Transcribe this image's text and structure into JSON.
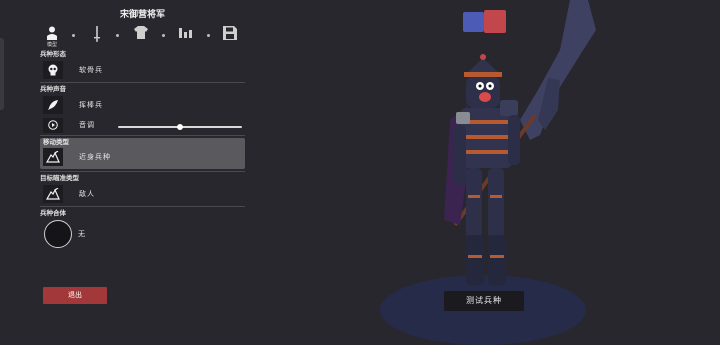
{
  "title": "宋御营将军",
  "tabs": [
    {
      "icon": "unit-icon",
      "label": "模型"
    },
    {
      "icon": "sword-icon",
      "label": ""
    },
    {
      "icon": "armor-icon",
      "label": ""
    },
    {
      "icon": "stats-icon",
      "label": ""
    },
    {
      "icon": "save-icon",
      "label": ""
    }
  ],
  "sections": {
    "form": {
      "title": "兵种形态",
      "value": "软骨兵"
    },
    "voice": {
      "title": "兵种声音",
      "value": "挥棒兵",
      "pitch_label": "音调",
      "pitch_level": 0.5
    },
    "movement": {
      "title": "移动类型",
      "value": "近身兵种"
    },
    "targeting": {
      "title": "目标瞄准类型",
      "value": "敌人"
    },
    "fusion": {
      "title": "兵种合体",
      "value": "无"
    }
  },
  "exit_label": "退出",
  "test_label": "测试兵种",
  "colors": {
    "swatch_primary": "#4c5cb6",
    "swatch_secondary": "#c2474d",
    "exit_button": "#a3383a",
    "background": "#28272d"
  }
}
